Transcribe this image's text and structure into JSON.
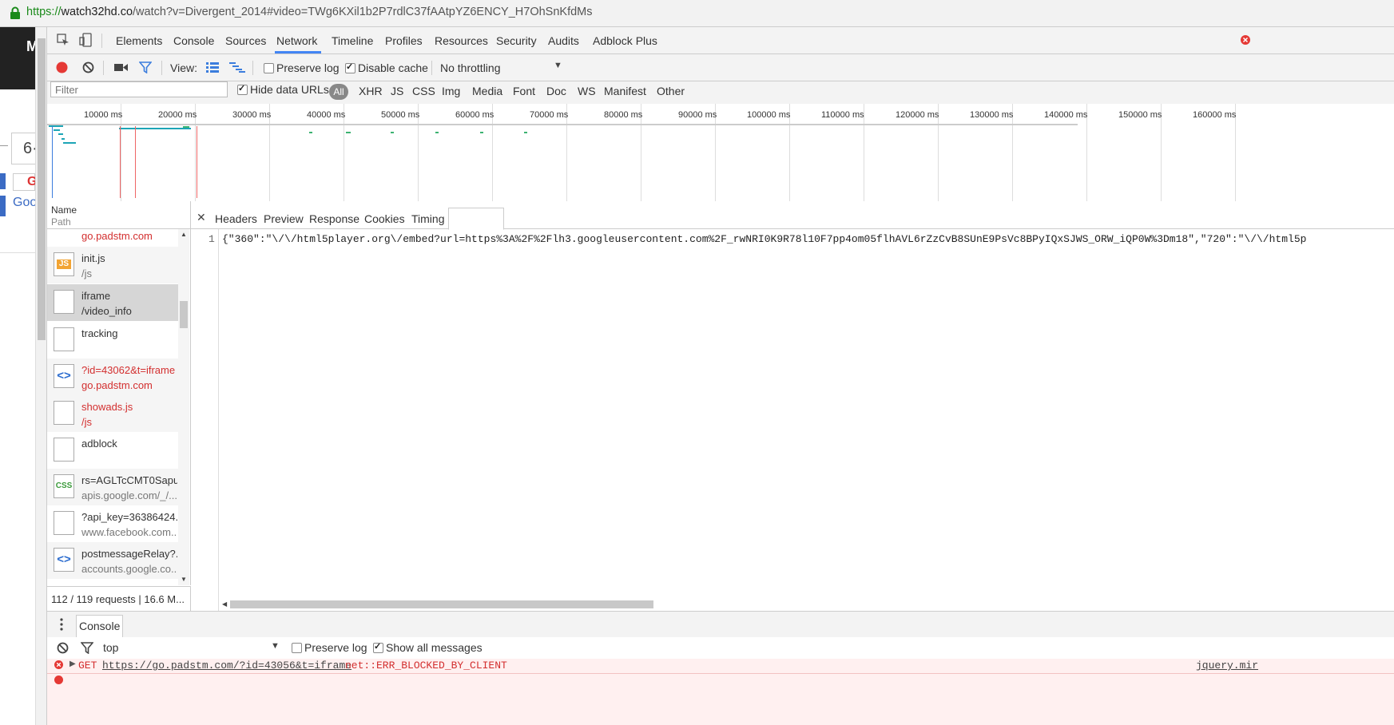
{
  "address_bar": {
    "url_scheme": "https://",
    "url_host": "watch32hd.co",
    "url_rest": "/watch?v=Divergent_2014#video=TWg6KXil1b2P7rdlC37fAAtpYZ6ENCY_H7OhSnKfdMs"
  },
  "page_peek": {
    "letter": "M",
    "box_text": "6·",
    "red_letter": "G",
    "blue_text": "Goo"
  },
  "devtools": {
    "tabs": [
      "Elements",
      "Console",
      "Sources",
      "Network",
      "Timeline",
      "Profiles",
      "Resources",
      "Security",
      "Audits",
      "Adblock Plus"
    ],
    "active_tab": "Network",
    "toolbar": {
      "view_label": "View:",
      "preserve_log": "Preserve log",
      "disable_cache": "Disable cache",
      "throttling": "No throttling"
    },
    "filter": {
      "placeholder": "Filter",
      "hide_data_urls": "Hide data URLs",
      "types": [
        "All",
        "XHR",
        "JS",
        "CSS",
        "Img",
        "Media",
        "Font",
        "Doc",
        "WS",
        "Manifest",
        "Other"
      ]
    },
    "overview_ticks": [
      "10000 ms",
      "20000 ms",
      "30000 ms",
      "40000 ms",
      "50000 ms",
      "60000 ms",
      "70000 ms",
      "80000 ms",
      "90000 ms",
      "100000 ms",
      "110000 ms",
      "120000 ms",
      "130000 ms",
      "140000 ms",
      "150000 ms",
      "160000 ms"
    ],
    "requests_header": {
      "name": "Name",
      "path": "Path"
    },
    "requests": [
      {
        "name": "",
        "path": "go.padstm.com",
        "icon": "",
        "state": "error"
      },
      {
        "name": "init.js",
        "path": "/js",
        "icon": "JS",
        "state": "normal"
      },
      {
        "name": "iframe",
        "path": "/video_info",
        "icon": "",
        "state": "selected"
      },
      {
        "name": "tracking",
        "path": "",
        "icon": "",
        "state": "normal"
      },
      {
        "name": "?id=43062&t=iframe",
        "path": "go.padstm.com",
        "icon": "<>",
        "state": "error"
      },
      {
        "name": "showads.js",
        "path": "/js",
        "icon": "",
        "state": "error"
      },
      {
        "name": "adblock",
        "path": "",
        "icon": "",
        "state": "normal"
      },
      {
        "name": "rs=AGLTcCMT0Sapu...",
        "path": "apis.google.com/_/...",
        "icon": "CSS",
        "state": "normal"
      },
      {
        "name": "?api_key=36386424...",
        "path": "www.facebook.com...",
        "icon": "",
        "state": "normal"
      },
      {
        "name": "postmessageRelay?...",
        "path": "accounts.google.co...",
        "icon": "<>",
        "state": "normal"
      }
    ],
    "requests_status": "112 / 119 requests  |  16.6 M...",
    "detail_tabs": [
      "Headers",
      "Preview",
      "Response",
      "Cookies",
      "Timing"
    ],
    "detail_active": "Response",
    "response": {
      "line_number": "1",
      "text": "{\"360\":\"\\/\\/html5player.org\\/embed?url=https%3A%2F%2Flh3.googleusercontent.com%2F_rwNRI0K9R78l10F7pp4om05flhAVL6rZzCvB8SUnE9PsVc8BPyIQxSJWS_ORW_iQP0W%3Dm18\",\"720\":\"\\/\\/html5p"
    },
    "console": {
      "tab": "Console",
      "context": "top",
      "preserve_log": "Preserve log",
      "show_all": "Show all messages",
      "error": {
        "method": "GET",
        "url": "https://go.padstm.com/?id=43056&t=iframe",
        "message": "net::ERR_BLOCKED_BY_CLIENT",
        "source": "jquery.mir"
      }
    }
  },
  "colors": {
    "accent": "#4285f4",
    "error": "#d32f2f",
    "record": "#e53935",
    "waterfall": "#1da5b6"
  }
}
